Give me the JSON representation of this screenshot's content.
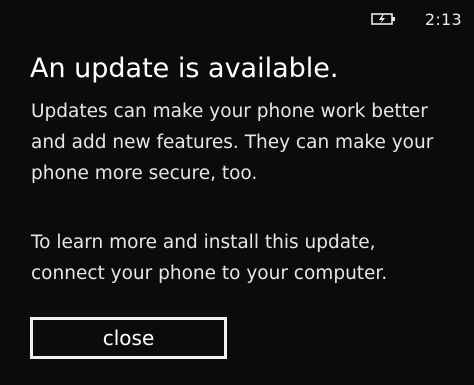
{
  "status_bar": {
    "battery_icon": "battery-charging-icon",
    "time": "2:13"
  },
  "dialog": {
    "title": "An update is available.",
    "paragraph1_lines": [
      "Updates can make your phone work better",
      "and add new features. They can make your",
      "phone more secure, too."
    ],
    "paragraph2_lines": [
      "To learn more and install this update,",
      "connect your phone to your computer."
    ],
    "close_label": "close"
  },
  "colors": {
    "background": "#0b0b0b",
    "text": "#f2f2f2",
    "button_border": "#f0f0f0"
  }
}
